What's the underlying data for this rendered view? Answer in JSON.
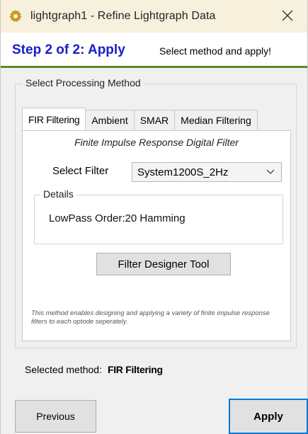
{
  "window": {
    "title": "lightgraph1 - Refine Lightgraph Data",
    "icon": "gear-icon",
    "close_glyph": "✕"
  },
  "header": {
    "step_title": "Step 2 of 2: Apply",
    "step_description": "Select method and apply!",
    "accent_color": "#1520c8",
    "separator_color": "#5a8a2a"
  },
  "method_group": {
    "label": "Select Processing Method",
    "tabs": [
      {
        "label": "FIR Filtering",
        "active": true
      },
      {
        "label": "Ambient",
        "active": false
      },
      {
        "label": "SMAR",
        "active": false
      },
      {
        "label": "Median Filtering",
        "active": false
      }
    ],
    "fir_panel": {
      "subtitle": "Finite Impulse Response Digital Filter",
      "select_filter_label": "Select Filter",
      "selected_filter": "System1200S_2Hz",
      "details_label": "Details",
      "details_value": "LowPass Order:20 Hamming",
      "designer_button": "Filter Designer Tool",
      "info_text": "This method enables designing and applying a variety of finite impulse response filters to each optode seperately."
    }
  },
  "status": {
    "selected_label": "Selected method:",
    "selected_value": "FIR Filtering"
  },
  "footer": {
    "previous_label": "Previous",
    "apply_label": "Apply",
    "apply_focus_color": "#0078d7"
  }
}
